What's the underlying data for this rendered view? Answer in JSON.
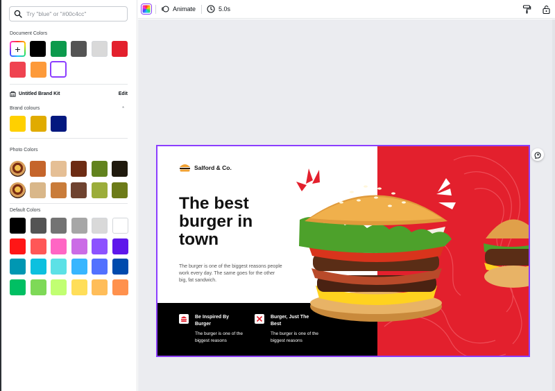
{
  "search": {
    "placeholder": "Try \"blue\" or \"#00c4cc\""
  },
  "document_colors": {
    "title": "Document Colors",
    "add_label": "+",
    "swatches": [
      "#000000",
      "#0c9a4c",
      "#545454",
      "#d9d9d9",
      "#e3202d",
      "#ef4350",
      "#fd9a3a",
      "#ffffff"
    ]
  },
  "brand_kit": {
    "name": "Untitled Brand Kit",
    "edit_label": "Edit",
    "colours_title": "Brand colours",
    "star": "*",
    "swatches": [
      "#ffd000",
      "#e0ab00",
      "#03187f"
    ]
  },
  "photo_colors": {
    "title": "Photo Colors",
    "row1": [
      "#c5652b",
      "#e5bf95",
      "#6d2c14",
      "#62831e",
      "#201a0e"
    ],
    "row2": [
      "#d9b789",
      "#c97c3a",
      "#6f4330",
      "#9bad3a",
      "#6c7b18"
    ]
  },
  "default_colors": {
    "title": "Default Colors",
    "rows": [
      [
        "#000000",
        "#545454",
        "#737373",
        "#a6a6a6",
        "#d9d9d9",
        "#ffffff"
      ],
      [
        "#ff1616",
        "#ff5757",
        "#ff66c4",
        "#cb6ce6",
        "#8c52ff",
        "#5e17eb"
      ],
      [
        "#0097b2",
        "#0cc0df",
        "#5ce1e6",
        "#38b6ff",
        "#5271ff",
        "#004aad"
      ],
      [
        "#00bf63",
        "#7ed957",
        "#c1ff72",
        "#ffde59",
        "#ffbd59",
        "#ff914d"
      ]
    ]
  },
  "toolbar": {
    "animate_label": "Animate",
    "duration_label": "5.0s"
  },
  "design": {
    "brand_name": "Salford & Co.",
    "headline": "The best burger in town",
    "body": "The burger is one of the biggest reasons people work every day. The same goes for the other big, fat sandwich.",
    "features": [
      {
        "title": "Be Inspired By Burger",
        "desc": "The burger is one of the biggest reasons"
      },
      {
        "title": "Burger, Just The Best",
        "desc": "The burger is one of the biggest reasons"
      }
    ],
    "accent_red": "#e3202d"
  }
}
